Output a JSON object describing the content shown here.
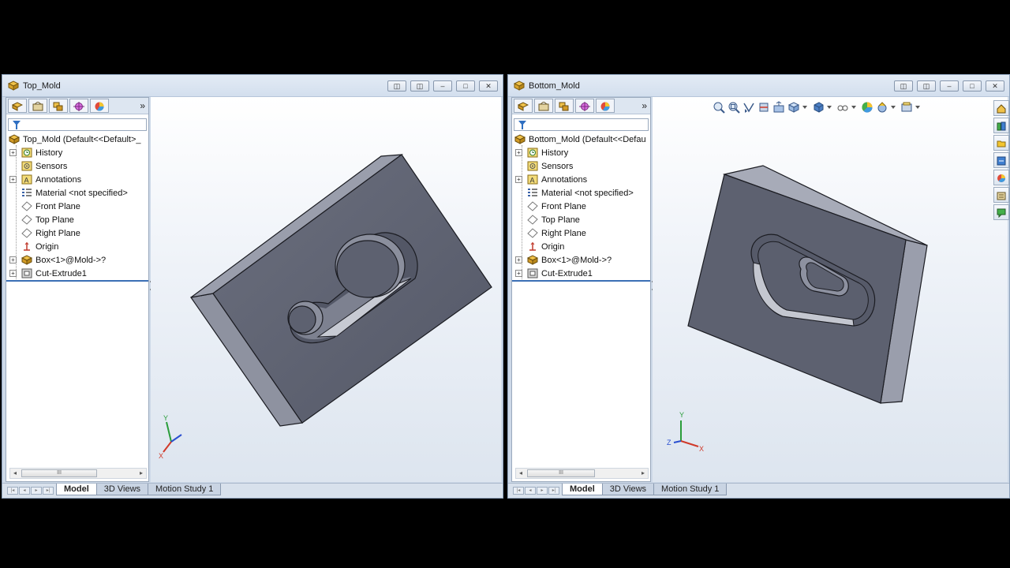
{
  "windows": [
    {
      "title": "Top_Mold",
      "root_label": "Top_Mold  (Default<<Default>_",
      "tree": [
        {
          "label": "History",
          "icon": "history-icon",
          "expandable": true
        },
        {
          "label": "Sensors",
          "icon": "sensors-icon",
          "expandable": false
        },
        {
          "label": "Annotations",
          "icon": "annotations-icon",
          "expandable": true
        },
        {
          "label": "Material <not specified>",
          "icon": "material-icon",
          "expandable": false
        },
        {
          "label": "Front Plane",
          "icon": "plane-icon",
          "expandable": false
        },
        {
          "label": "Top Plane",
          "icon": "plane-icon",
          "expandable": false
        },
        {
          "label": "Right Plane",
          "icon": "plane-icon",
          "expandable": false
        },
        {
          "label": "Origin",
          "icon": "origin-icon",
          "expandable": false
        },
        {
          "label": "Box<1>@Mold->?",
          "icon": "box-part-icon",
          "expandable": true
        },
        {
          "label": "Cut-Extrude1",
          "icon": "cut-extrude-icon",
          "expandable": true
        }
      ],
      "tabs": [
        "Model",
        "3D Views",
        "Motion Study 1"
      ],
      "active_tab": "Model",
      "triad": {
        "y": "Y",
        "x": "X"
      }
    },
    {
      "title": "Bottom_Mold",
      "root_label": "Bottom_Mold  (Default<<Defau",
      "tree": [
        {
          "label": "History",
          "icon": "history-icon",
          "expandable": true
        },
        {
          "label": "Sensors",
          "icon": "sensors-icon",
          "expandable": false
        },
        {
          "label": "Annotations",
          "icon": "annotations-icon",
          "expandable": true
        },
        {
          "label": "Material <not specified>",
          "icon": "material-icon",
          "expandable": false
        },
        {
          "label": "Front Plane",
          "icon": "plane-icon",
          "expandable": false
        },
        {
          "label": "Top Plane",
          "icon": "plane-icon",
          "expandable": false
        },
        {
          "label": "Right Plane",
          "icon": "plane-icon",
          "expandable": false
        },
        {
          "label": "Origin",
          "icon": "origin-icon",
          "expandable": false
        },
        {
          "label": "Box<1>@Mold->?",
          "icon": "box-part-icon",
          "expandable": true
        },
        {
          "label": "Cut-Extrude1",
          "icon": "cut-extrude-icon",
          "expandable": true
        }
      ],
      "tabs": [
        "Model",
        "3D Views",
        "Motion Study 1"
      ],
      "active_tab": "Model",
      "triad": {
        "y": "Y",
        "x": "X",
        "z": "Z"
      }
    }
  ],
  "panel_toolbar": {
    "more": "»"
  },
  "scroll_thumb": "III",
  "colors": {
    "part_face": "#5d6170",
    "part_side": "#8a8e9c",
    "part_edge": "#1b1c22",
    "viewport_top": "#ffffff",
    "viewport_bottom": "#dde5ef",
    "rollback_bar": "#3b6fb5"
  }
}
